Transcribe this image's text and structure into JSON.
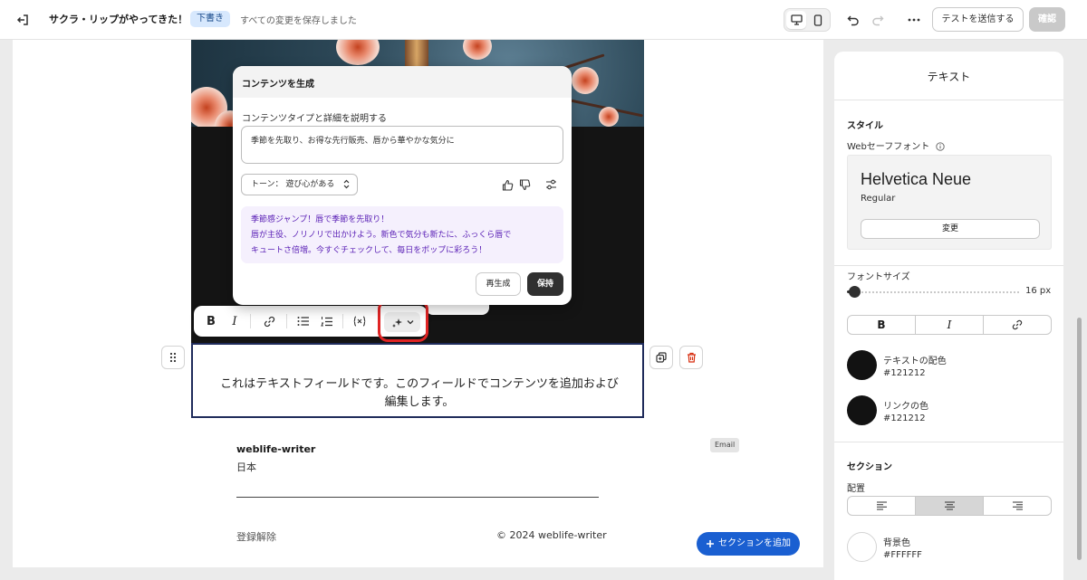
{
  "topbar": {
    "title": "サクラ・リップがやってきた！",
    "badge": "下書き",
    "status": "すべての変更を保存しました",
    "test_button": "テストを送信する",
    "confirm_button": "確認"
  },
  "hero": {
    "alt": "cherry blossom lipstick image"
  },
  "email": {
    "text_block": "これはテキストフィールドです。このフィールドでコンテンツを追加および編集します。",
    "footer_name": "weblife-writer",
    "footer_country": "日本",
    "unsubscribe": "登録解除",
    "copyright": "© 2024 weblife-writer",
    "email_tag": "Email"
  },
  "add_section_label": "セクションを追加",
  "dialog": {
    "title": "コンテンツを生成",
    "label": "コンテンツタイプと詳細を説明する",
    "input_value": "季節を先取り、お得な先行販売、唇から華やかな気分に",
    "tone": "トーン： 遊び心がある",
    "result_lines": [
      "季節感ジャンプ！唇で季節を先取り！",
      "唇が主役、ノリノリで出かけよう。新色で気分も新たに、ふっくら唇で",
      "キュートさ倍増。今すぐチェックして、毎日をポップに彩ろう！"
    ],
    "regenerate": "再生成",
    "keep": "保持"
  },
  "panel": {
    "title": "テキスト",
    "style_heading": "スタイル",
    "websafe_label": "Webセーフフォント",
    "font_name": "Helvetica Neue",
    "font_style": "Regular",
    "change_button": "変更",
    "font_size_label": "フォントサイズ",
    "font_size_value": "16 px",
    "font_size_fraction": 0.02,
    "text_color_label": "テキストの配色",
    "text_color_hex": "#121212",
    "link_color_label": "リンクの色",
    "link_color_hex": "#121212",
    "section_heading": "セクション",
    "alignment_label": "配置",
    "alignment_selected": "center",
    "bg_color_label": "背景色",
    "bg_color_hex": "#FFFFFF"
  },
  "colors": {
    "accent": "#1a5fd1",
    "highlight": "#e02424",
    "ai_text": "#5b21b6"
  }
}
